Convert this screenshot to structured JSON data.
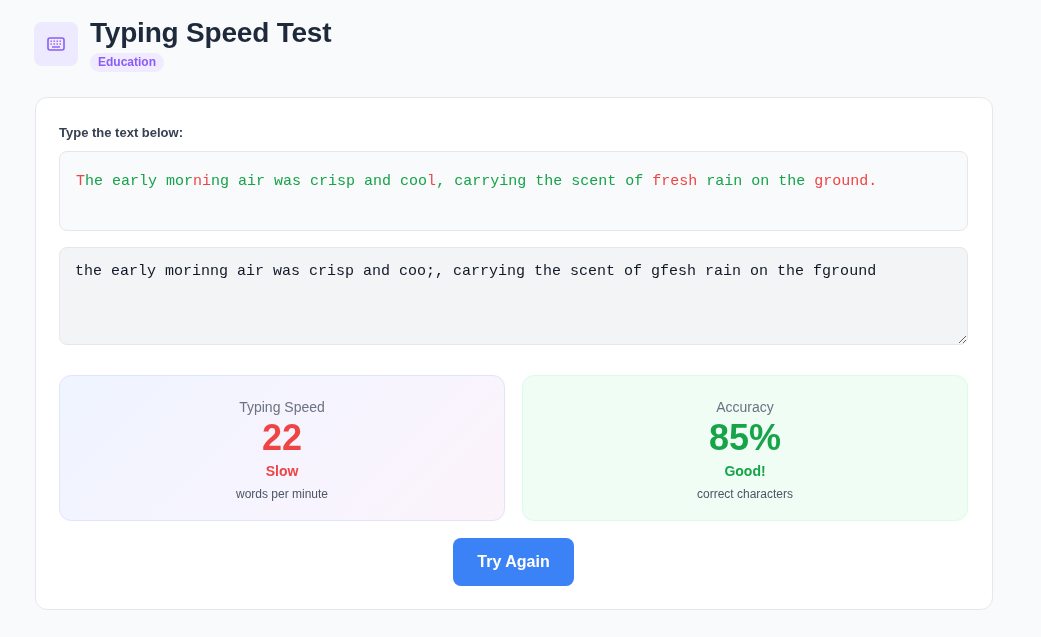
{
  "header": {
    "title": "Typing Speed Test",
    "badge": "Education"
  },
  "test": {
    "prompt": "Type the text below:",
    "reference": [
      {
        "text": "T",
        "correct": false
      },
      {
        "text": "he early mor",
        "correct": true
      },
      {
        "text": "ni",
        "correct": false
      },
      {
        "text": "ng air was crisp and coo",
        "correct": true
      },
      {
        "text": "l",
        "correct": false
      },
      {
        "text": ", carrying the scent of ",
        "correct": true
      },
      {
        "text": "fresh",
        "correct": false
      },
      {
        "text": " rain on the ",
        "correct": true
      },
      {
        "text": "ground.",
        "correct": false
      }
    ],
    "typed": "the early morinng air was crisp and coo;, carrying the scent of gfesh rain on the fground"
  },
  "results": [
    {
      "kind": "speed",
      "label": "Typing Speed",
      "value": "22",
      "rating": "Slow",
      "unit": "words per minute",
      "color": "#ef4444"
    },
    {
      "kind": "accuracy",
      "label": "Accuracy",
      "value": "85%",
      "rating": "Good!",
      "unit": "correct characters",
      "color": "#16a34a"
    }
  ],
  "button": "Try Again"
}
